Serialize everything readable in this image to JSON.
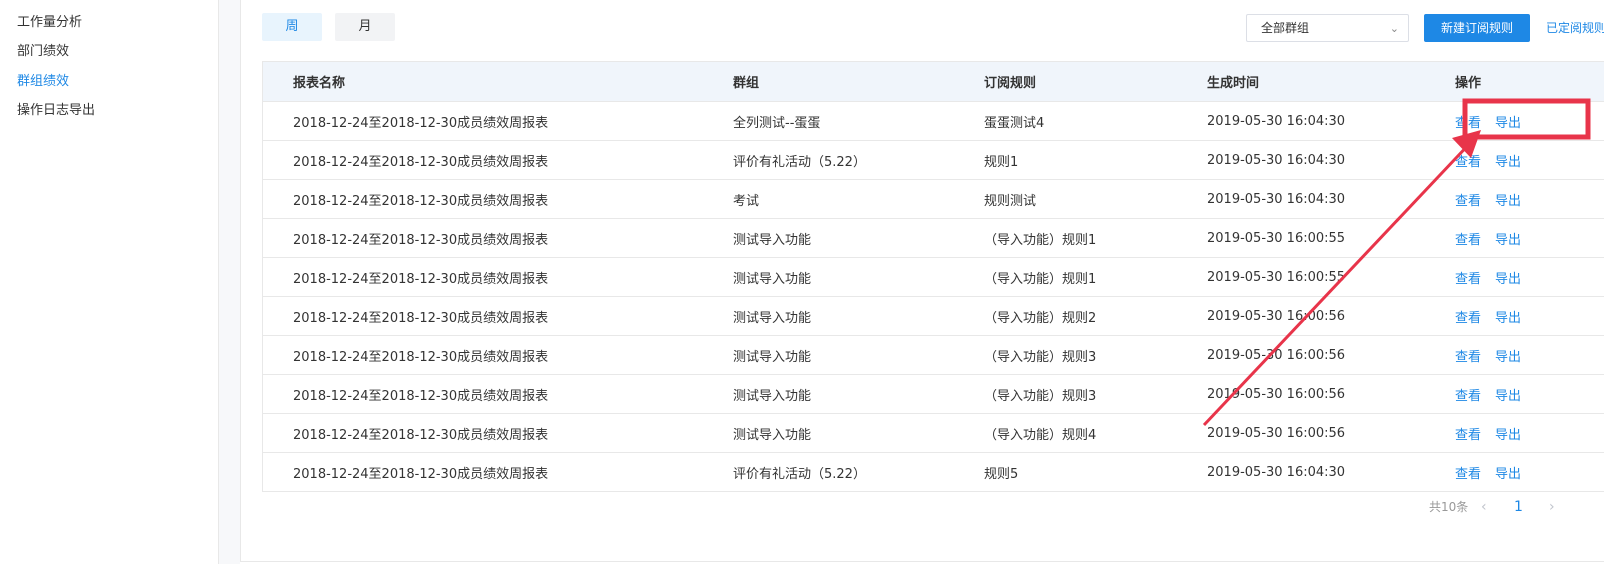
{
  "sidebar": {
    "items": [
      {
        "label": "工作量分析"
      },
      {
        "label": "部门绩效"
      },
      {
        "label": "群组绩效"
      },
      {
        "label": "操作日志导出"
      }
    ]
  },
  "toolbar": {
    "tab_week": "周",
    "tab_month": "月",
    "group_select": "全部群组",
    "new_rule_button": "新建订阅规则",
    "subscribed_link": "已定阅规则"
  },
  "table": {
    "headers": [
      "报表名称",
      "群组",
      "订阅规则",
      "生成时间",
      "操作"
    ],
    "rows": [
      {
        "name": "2018-12-24至2018-12-30成员绩效周报表",
        "group": "全列测试--蛋蛋",
        "rule": "蛋蛋测试4",
        "time": "2019-05-30 16:04:30",
        "view": "查看",
        "export": "导出"
      },
      {
        "name": "2018-12-24至2018-12-30成员绩效周报表",
        "group": "评价有礼活动（5.22）",
        "rule": "规则1",
        "time": "2019-05-30 16:04:30",
        "view": "查看",
        "export": "导出"
      },
      {
        "name": "2018-12-24至2018-12-30成员绩效周报表",
        "group": "考试",
        "rule": "规则测试",
        "time": "2019-05-30 16:04:30",
        "view": "查看",
        "export": "导出"
      },
      {
        "name": "2018-12-24至2018-12-30成员绩效周报表",
        "group": "测试导入功能",
        "rule": "（导入功能）规则1",
        "time": "2019-05-30 16:00:55",
        "view": "查看",
        "export": "导出"
      },
      {
        "name": "2018-12-24至2018-12-30成员绩效周报表",
        "group": "测试导入功能",
        "rule": "（导入功能）规则1",
        "time": "2019-05-30 16:00:55",
        "view": "查看",
        "export": "导出"
      },
      {
        "name": "2018-12-24至2018-12-30成员绩效周报表",
        "group": "测试导入功能",
        "rule": "（导入功能）规则2",
        "time": "2019-05-30 16:00:56",
        "view": "查看",
        "export": "导出"
      },
      {
        "name": "2018-12-24至2018-12-30成员绩效周报表",
        "group": "测试导入功能",
        "rule": "（导入功能）规则3",
        "time": "2019-05-30 16:00:56",
        "view": "查看",
        "export": "导出"
      },
      {
        "name": "2018-12-24至2018-12-30成员绩效周报表",
        "group": "测试导入功能",
        "rule": "（导入功能）规则3",
        "time": "2019-05-30 16:00:56",
        "view": "查看",
        "export": "导出"
      },
      {
        "name": "2018-12-24至2018-12-30成员绩效周报表",
        "group": "测试导入功能",
        "rule": "（导入功能）规则4",
        "time": "2019-05-30 16:00:56",
        "view": "查看",
        "export": "导出"
      },
      {
        "name": "2018-12-24至2018-12-30成员绩效周报表",
        "group": "评价有礼活动（5.22）",
        "rule": "规则5",
        "time": "2019-05-30 16:04:30",
        "view": "查看",
        "export": "导出"
      }
    ]
  },
  "pagination": {
    "total": "共10条",
    "prev": "‹",
    "current": "1",
    "next": "›"
  },
  "colors": {
    "accent": "#1e88e5",
    "annotation": "#e8344a"
  }
}
